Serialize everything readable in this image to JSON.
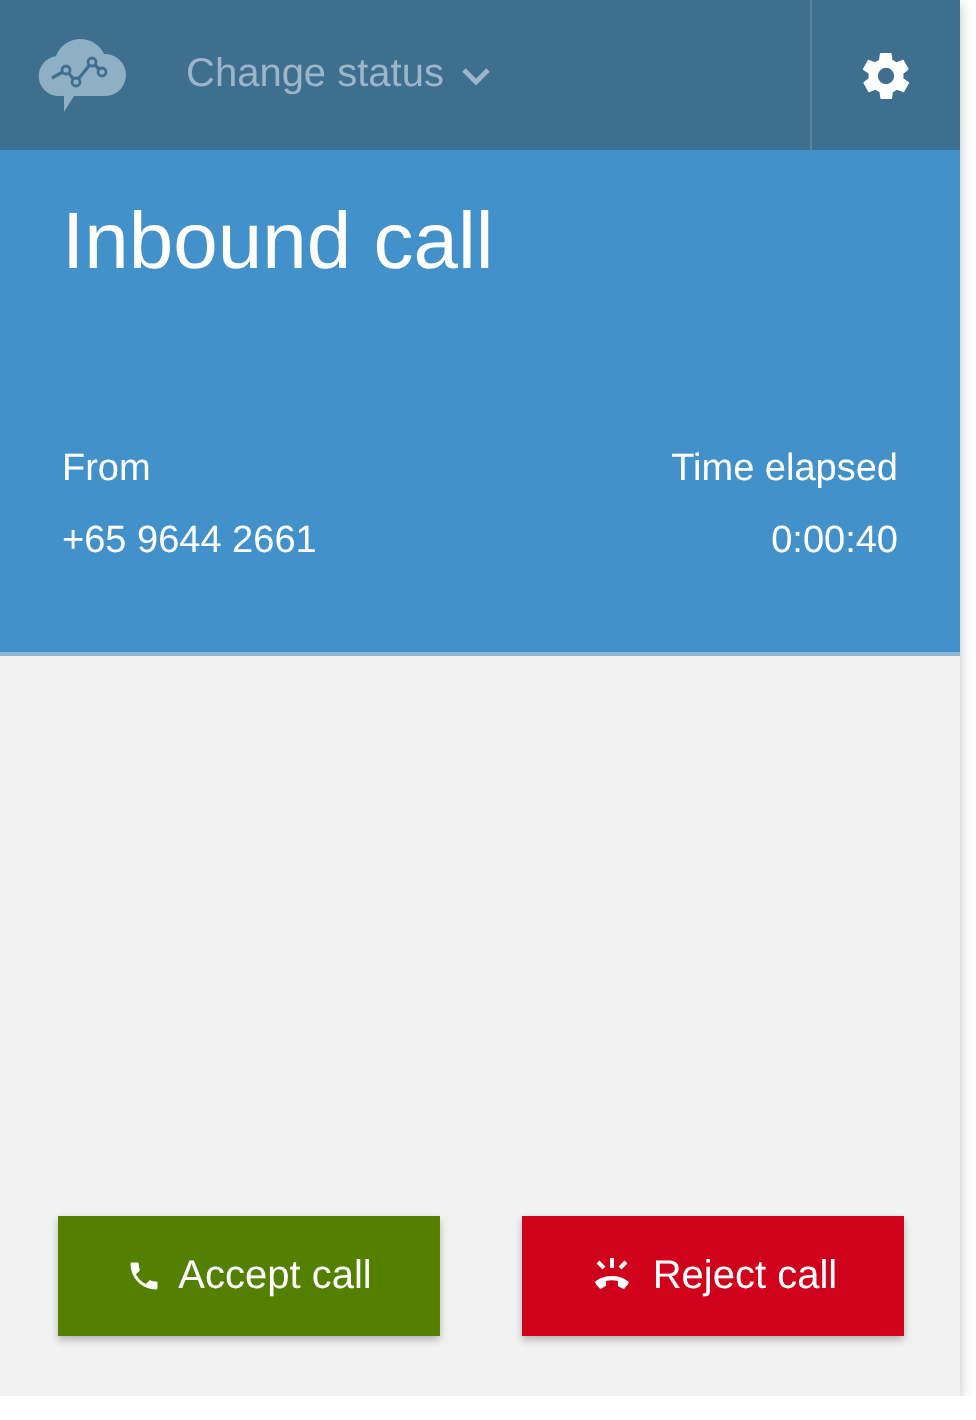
{
  "header": {
    "status_label": "Change status"
  },
  "call": {
    "title": "Inbound call",
    "from_label": "From",
    "from_value": "+65 9644 2661",
    "elapsed_label": "Time elapsed",
    "elapsed_value": "0:00:40"
  },
  "actions": [
    {
      "kind": "accept",
      "label": "Accept call"
    },
    {
      "kind": "reject",
      "label": "Reject call"
    }
  ]
}
